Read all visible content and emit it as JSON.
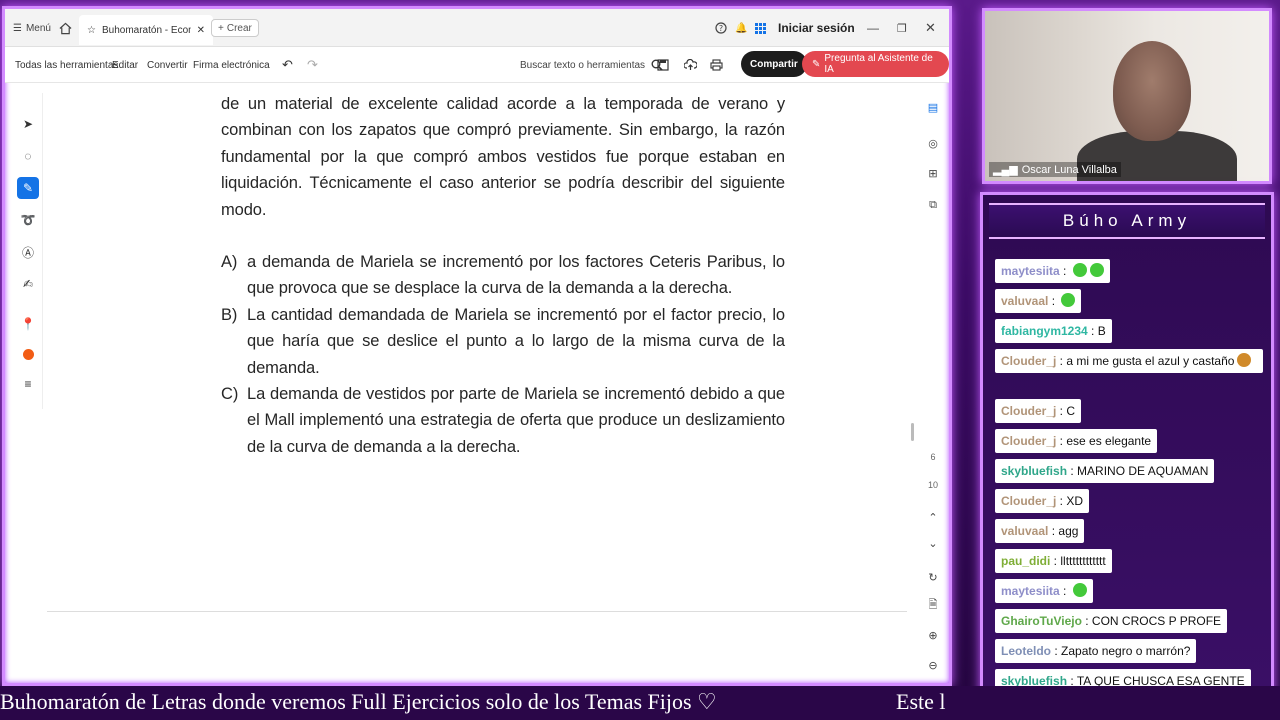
{
  "app": {
    "menu_label": "Menú",
    "tab_title": "Buhomaratón - Econo...",
    "create_label": "Crear",
    "sign_in": "Iniciar sesión"
  },
  "toolbar": {
    "all_tools": "Todas las herramientas",
    "edit": "Editar",
    "convert": "Convertir",
    "e_sign": "Firma electrónica",
    "search": "Buscar texto o herramientas",
    "share": "Compartir",
    "ai_assistant": "Pregunta al Asistente de IA"
  },
  "document": {
    "paragraph": "de un material de excelente calidad acorde a la temporada de verano y combinan con los zapatos que compró previamente. Sin embargo, la razón fundamental por la que compró ambos vestidos fue porque estaban en liquidación. Técnicamente el caso anterior se podría describir del siguiente modo.",
    "options": [
      {
        "letter": "A)",
        "text": "a demanda de Mariela se incrementó por los factores Ceteris Paribus, lo que provoca que se desplace la curva de la demanda a la derecha."
      },
      {
        "letter": "B)",
        "text": "La cantidad demandada de Mariela se incrementó por el factor precio, lo que haría que se deslice el punto a lo largo de la misma curva de la demanda."
      },
      {
        "letter": "C)",
        "text": "La demanda de vestidos por parte de Mariela se incrementó debido a que el Mall implementó una estrategia de oferta que produce un deslizamiento de la curva de demanda a la derecha."
      }
    ]
  },
  "right_rail": {
    "page_current": "6",
    "page_total": "10"
  },
  "webcam": {
    "name": "Oscar Luna Villalba"
  },
  "chat": {
    "title": "Búho Army",
    "messages": [
      {
        "user": "maytesiita",
        "text": "",
        "color": "#8e8ec9",
        "emoji": [
          "#43c93a",
          "#43c93a"
        ]
      },
      {
        "user": "valuvaal",
        "text": "",
        "color": "#b19478",
        "emoji": [
          "#43c93a"
        ]
      },
      {
        "user": "fabiangym1234",
        "text": "B",
        "color": "#2fb7a2",
        "emoji": []
      },
      {
        "user": "Clouder_j",
        "text": "a mi me gusta el azul y castaño",
        "color": "#b19478",
        "emoji": [
          "#d08a2a"
        ]
      },
      {
        "user": "Clouder_j",
        "text": "C",
        "color": "#b19478",
        "emoji": []
      },
      {
        "user": "Clouder_j",
        "text": "ese es elegante",
        "color": "#b19478",
        "emoji": []
      },
      {
        "user": "skybluefish",
        "text": "MARINO DE AQUAMAN",
        "color": "#2fa68a",
        "emoji": []
      },
      {
        "user": "Clouder_j",
        "text": "XD",
        "color": "#b19478",
        "emoji": []
      },
      {
        "user": "valuvaal",
        "text": "agg",
        "color": "#b19478",
        "emoji": []
      },
      {
        "user": "pau_didi",
        "text": "lltttttttttttt",
        "color": "#7fae36",
        "emoji": []
      },
      {
        "user": "maytesiita",
        "text": "",
        "color": "#8e8ec9",
        "emoji": [
          "#43c93a"
        ]
      },
      {
        "user": "GhairoTuViejo",
        "text": "CON CROCS P PROFE",
        "color": "#5fa84a",
        "emoji": []
      },
      {
        "user": "Leoteldo",
        "text": "Zapato negro o marrón?",
        "color": "#7f8fb5",
        "emoji": []
      },
      {
        "user": "skybluefish",
        "text": "TA QUE CHUSCA ESA GENTE",
        "color": "#2fa68a",
        "emoji": []
      }
    ]
  },
  "ticker": {
    "text": "Buhomaratón de Letras donde veremos Full Ejercicios solo de los Temas Fijos ♡",
    "text2": "Este l"
  }
}
